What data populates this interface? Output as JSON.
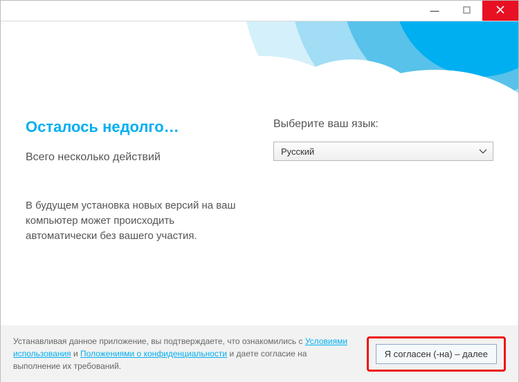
{
  "titlebar": {
    "minimize_icon": "minimize-icon",
    "maximize_icon": "maximize-icon",
    "close_icon": "close-icon"
  },
  "main": {
    "heading": "Осталось недолго…",
    "subheading": "Всего несколько действий",
    "paragraph": "В будущем установка новых версий               на ваш компьютер может происходить автоматически без вашего участия."
  },
  "language": {
    "label": "Выберите ваш язык:",
    "selected": "Русский"
  },
  "footer": {
    "legal_prefix": "Устанавливая данное приложение, вы подтверждаете, что ознакомились с ",
    "terms_link": "Условиями использования",
    "legal_mid": " и ",
    "privacy_link": "Положениями о конфиденциальности",
    "legal_suffix": " и даете согласие на выполнение их требований.",
    "next_button": "Я согласен (-на) – далее"
  }
}
